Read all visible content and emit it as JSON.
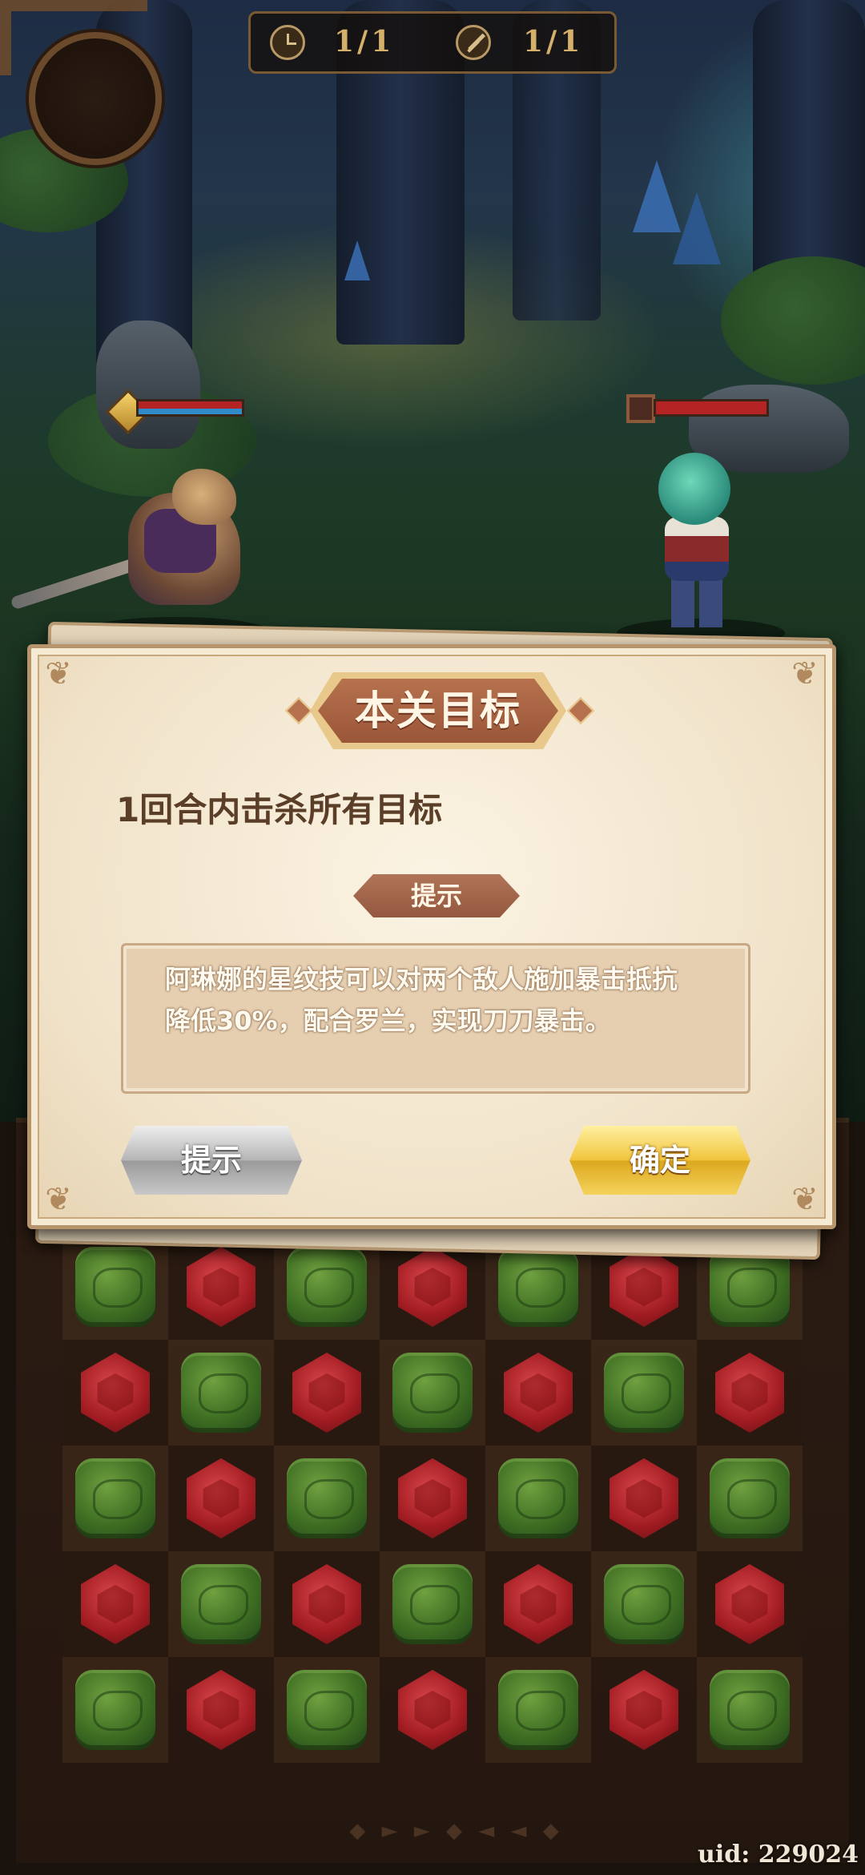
{
  "hud": {
    "turns_counter": "1/1",
    "attacks_counter": "1/1",
    "turns_icon": "clock-icon",
    "attacks_icon": "sword-icon"
  },
  "battle": {
    "hero": {
      "hp_fraction": 1.0,
      "mp_fraction": 1.0
    },
    "enemy": {
      "hp_fraction": 1.0
    }
  },
  "dialog": {
    "title": "本关目标",
    "objective": "1回合内击杀所有目标",
    "hint_label": "提示",
    "hint_text": "阿琳娜的星纹技可以对两个敌人施加暴击抵抗降低30%，配合罗兰，实现刀刀暴击。",
    "hint_button": "提示",
    "confirm_button": "确定"
  },
  "board": {
    "rows": [
      [
        "green",
        "red",
        "green",
        "red",
        "green",
        "red",
        "green"
      ],
      [
        "red",
        "green",
        "red",
        "green",
        "red",
        "green",
        "red"
      ],
      [
        "green",
        "red",
        "green",
        "red",
        "green",
        "red",
        "green"
      ],
      [
        "red",
        "green",
        "red",
        "green",
        "red",
        "green",
        "red"
      ],
      [
        "green",
        "red",
        "green",
        "red",
        "green",
        "red",
        "green"
      ]
    ]
  },
  "footer": {
    "uid": "uid: 229024"
  },
  "colors": {
    "gem_green": "#3e6e22",
    "gem_red": "#a11c22",
    "confirm_gold": "#f1c43c",
    "ribbon_brown": "#b6714e"
  }
}
